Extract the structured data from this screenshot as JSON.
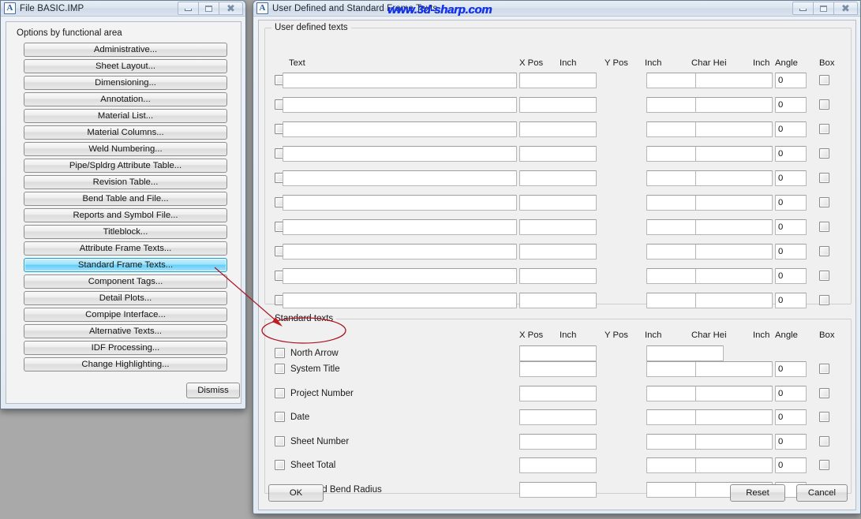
{
  "desktop": {
    "background": "#a9a9a9"
  },
  "left_window": {
    "title": "File BASIC.IMP",
    "icon": "autocad-a-icon",
    "section_label": "Options by functional area",
    "buttons": [
      {
        "label": "Administrative...",
        "selected": false
      },
      {
        "label": "Sheet Layout...",
        "selected": false
      },
      {
        "label": "Dimensioning...",
        "selected": false
      },
      {
        "label": "Annotation...",
        "selected": false
      },
      {
        "label": "Material List...",
        "selected": false
      },
      {
        "label": "Material Columns...",
        "selected": false
      },
      {
        "label": "Weld Numbering...",
        "selected": false
      },
      {
        "label": "Pipe/Spldrg Attribute Table...",
        "selected": false
      },
      {
        "label": "Revision Table...",
        "selected": false
      },
      {
        "label": "Bend Table and File...",
        "selected": false
      },
      {
        "label": "Reports and Symbol File...",
        "selected": false
      },
      {
        "label": "Titleblock...",
        "selected": false
      },
      {
        "label": "Attribute Frame Texts...",
        "selected": false
      },
      {
        "label": "Standard Frame Texts...",
        "selected": true
      },
      {
        "label": "Component Tags...",
        "selected": false
      },
      {
        "label": "Detail Plots...",
        "selected": false
      },
      {
        "label": "Compipe Interface...",
        "selected": false
      },
      {
        "label": "Alternative Texts...",
        "selected": false
      },
      {
        "label": "IDF Processing...",
        "selected": false
      },
      {
        "label": "Change Highlighting...",
        "selected": false
      }
    ],
    "dismiss_label": "Dismiss",
    "window_controls": {
      "minimize": "minimize-icon",
      "maximize": "maximize-icon",
      "close": "close-icon"
    }
  },
  "right_window": {
    "title": "User Defined and Standard Frame Texts",
    "icon": "autocad-a-icon",
    "watermark": "www.3d-sharp.com",
    "watermark_color": "#1433ee",
    "window_controls": {
      "minimize": "minimize-icon",
      "maximize": "maximize-icon",
      "close": "close-icon"
    },
    "user_defined": {
      "group_title": "User defined texts",
      "headers": {
        "text": "Text",
        "x_pos": "X Pos",
        "x_unit": "Inch",
        "y_pos": "Y Pos",
        "y_unit": "Inch",
        "char_hei": "Char Hei",
        "char_unit": "Inch",
        "angle": "Angle",
        "box": "Box"
      },
      "rows": [
        {
          "enabled": false,
          "text": "",
          "x_pos": "",
          "y_pos": "",
          "char_hei": "",
          "angle": "0",
          "box": false
        },
        {
          "enabled": false,
          "text": "",
          "x_pos": "",
          "y_pos": "",
          "char_hei": "",
          "angle": "0",
          "box": false
        },
        {
          "enabled": false,
          "text": "",
          "x_pos": "",
          "y_pos": "",
          "char_hei": "",
          "angle": "0",
          "box": false
        },
        {
          "enabled": false,
          "text": "",
          "x_pos": "",
          "y_pos": "",
          "char_hei": "",
          "angle": "0",
          "box": false
        },
        {
          "enabled": false,
          "text": "",
          "x_pos": "",
          "y_pos": "",
          "char_hei": "",
          "angle": "0",
          "box": false
        },
        {
          "enabled": false,
          "text": "",
          "x_pos": "",
          "y_pos": "",
          "char_hei": "",
          "angle": "0",
          "box": false
        },
        {
          "enabled": false,
          "text": "",
          "x_pos": "",
          "y_pos": "",
          "char_hei": "",
          "angle": "0",
          "box": false
        },
        {
          "enabled": false,
          "text": "",
          "x_pos": "",
          "y_pos": "",
          "char_hei": "",
          "angle": "0",
          "box": false
        },
        {
          "enabled": false,
          "text": "",
          "x_pos": "",
          "y_pos": "",
          "char_hei": "",
          "angle": "0",
          "box": false
        },
        {
          "enabled": false,
          "text": "",
          "x_pos": "",
          "y_pos": "",
          "char_hei": "",
          "angle": "0",
          "box": false
        }
      ]
    },
    "standard": {
      "group_title": "Standard texts",
      "headers": {
        "x_pos": "X Pos",
        "x_unit": "Inch",
        "y_pos": "Y Pos",
        "y_unit": "Inch",
        "char_hei": "Char Hei",
        "char_unit": "Inch",
        "angle": "Angle",
        "box": "Box"
      },
      "rows": [
        {
          "label": "North Arrow",
          "enabled": false,
          "x_pos": "",
          "y_pos": "",
          "has_char_hei": false,
          "char_hei": "",
          "angle": "",
          "box": false,
          "annotated": true
        },
        {
          "label": "System Title",
          "enabled": false,
          "x_pos": "",
          "y_pos": "",
          "has_char_hei": true,
          "char_hei": "",
          "angle": "0",
          "box": false,
          "annotated": false
        },
        {
          "label": "Project Number",
          "enabled": false,
          "x_pos": "",
          "y_pos": "",
          "has_char_hei": true,
          "char_hei": "",
          "angle": "0",
          "box": false,
          "annotated": false
        },
        {
          "label": "Date",
          "enabled": false,
          "x_pos": "",
          "y_pos": "",
          "has_char_hei": true,
          "char_hei": "",
          "angle": "0",
          "box": false,
          "annotated": false
        },
        {
          "label": "Sheet Number",
          "enabled": false,
          "x_pos": "",
          "y_pos": "",
          "has_char_hei": true,
          "char_hei": "",
          "angle": "0",
          "box": false,
          "annotated": false
        },
        {
          "label": "Sheet Total",
          "enabled": false,
          "x_pos": "",
          "y_pos": "",
          "has_char_hei": true,
          "char_hei": "",
          "angle": "0",
          "box": false,
          "annotated": false
        },
        {
          "label": "Standard Bend Radius",
          "enabled": false,
          "x_pos": "",
          "y_pos": "",
          "has_char_hei": true,
          "char_hei": "",
          "angle": "0",
          "box": false,
          "annotated": false
        }
      ]
    },
    "footer": {
      "ok_label": "OK",
      "reset_label": "Reset",
      "cancel_label": "Cancel"
    }
  },
  "annotation": {
    "type": "red-callout",
    "color": "#aa1420",
    "arrow_from": "standard-frame-texts-button",
    "arrow_to": "north-arrow-checkbox",
    "ellipse_around": "north-arrow-row"
  }
}
